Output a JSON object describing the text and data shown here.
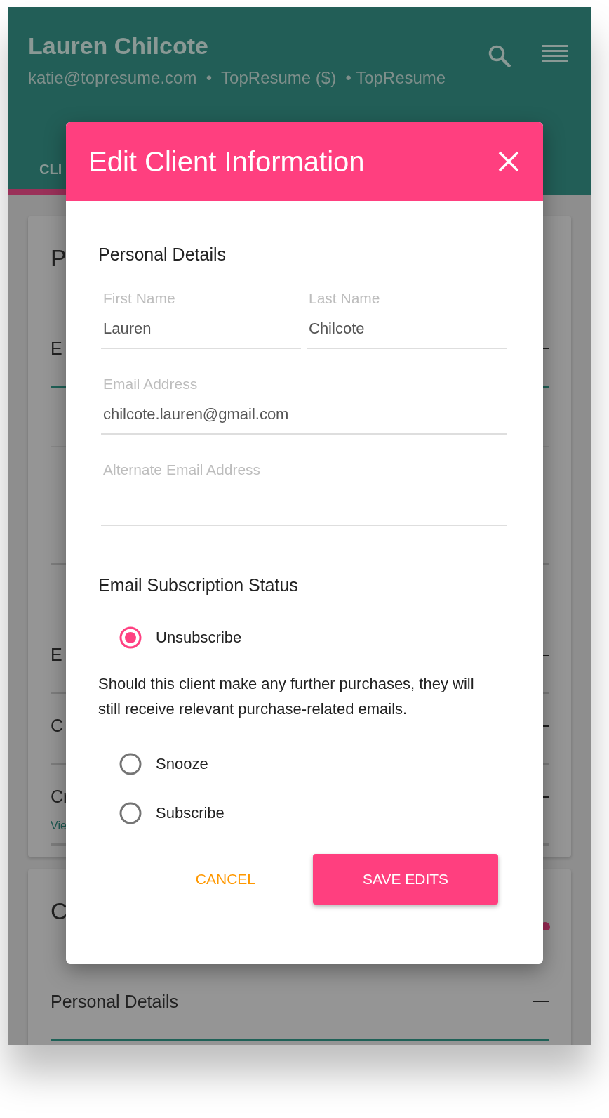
{
  "app_bar": {
    "title": "Lauren Chilcote",
    "subtitle": "katie@topresume.com  •  TopResume ($)  • TopResume"
  },
  "tabs": [
    {
      "label": "CLI",
      "selected": true
    }
  ],
  "cards": [
    {
      "title": "P",
      "sections": [
        {
          "label": "E",
          "expanded": true
        },
        {
          "label": "E",
          "expanded": false
        },
        {
          "label": "C",
          "expanded": false
        },
        {
          "label": "Cr",
          "expanded": false,
          "link": "Vie"
        }
      ]
    },
    {
      "title": "C",
      "sections": [
        {
          "label": "Personal Details",
          "expanded": true
        }
      ]
    }
  ],
  "dialog": {
    "title": "Edit Client Information",
    "personal": {
      "heading": "Personal Details",
      "fields": [
        {
          "label": "First Name",
          "value": "Lauren"
        },
        {
          "label": "Last Name",
          "value": "Chilcote"
        },
        {
          "label": "Email Address",
          "value": "chilcote.lauren@gmail.com"
        },
        {
          "label": "Alternate Email Address"
        }
      ]
    },
    "subscription": {
      "heading": "Email Subscription Status",
      "options": [
        {
          "label": "Unsubscribe",
          "selected": true,
          "note": "Should this client make any further purchases, they will still receive relevant purchase-related emails."
        },
        {
          "label": "Snooze",
          "selected": false
        },
        {
          "label": "Subscribe",
          "selected": false
        }
      ]
    },
    "buttons": [
      {
        "label": "CANCEL",
        "kind": "flat"
      },
      {
        "label": "SAVE EDITS",
        "kind": "raised"
      }
    ]
  }
}
